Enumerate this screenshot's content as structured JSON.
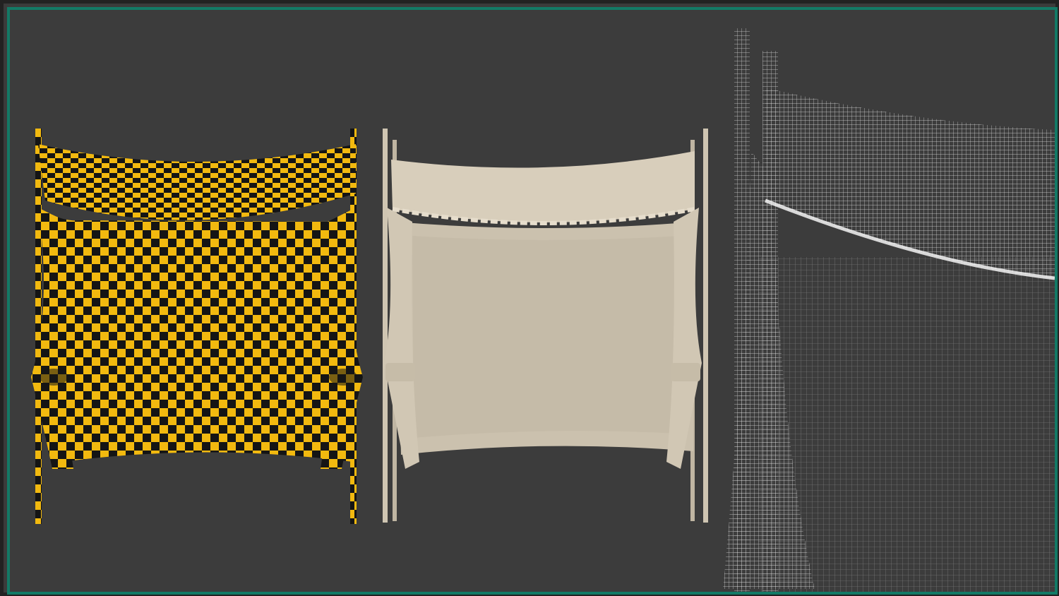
{
  "scene": {
    "background_color": "#3c3c3c",
    "frame_border_color": "#137a66",
    "panels": [
      {
        "name": "checker-uv-render",
        "fill_a": "#f2b90f",
        "fill_b": "#151515"
      },
      {
        "name": "clay-render",
        "fill": "#d4cab8"
      },
      {
        "name": "wireframe-closeup",
        "wire_color": "#ffffff"
      }
    ]
  }
}
